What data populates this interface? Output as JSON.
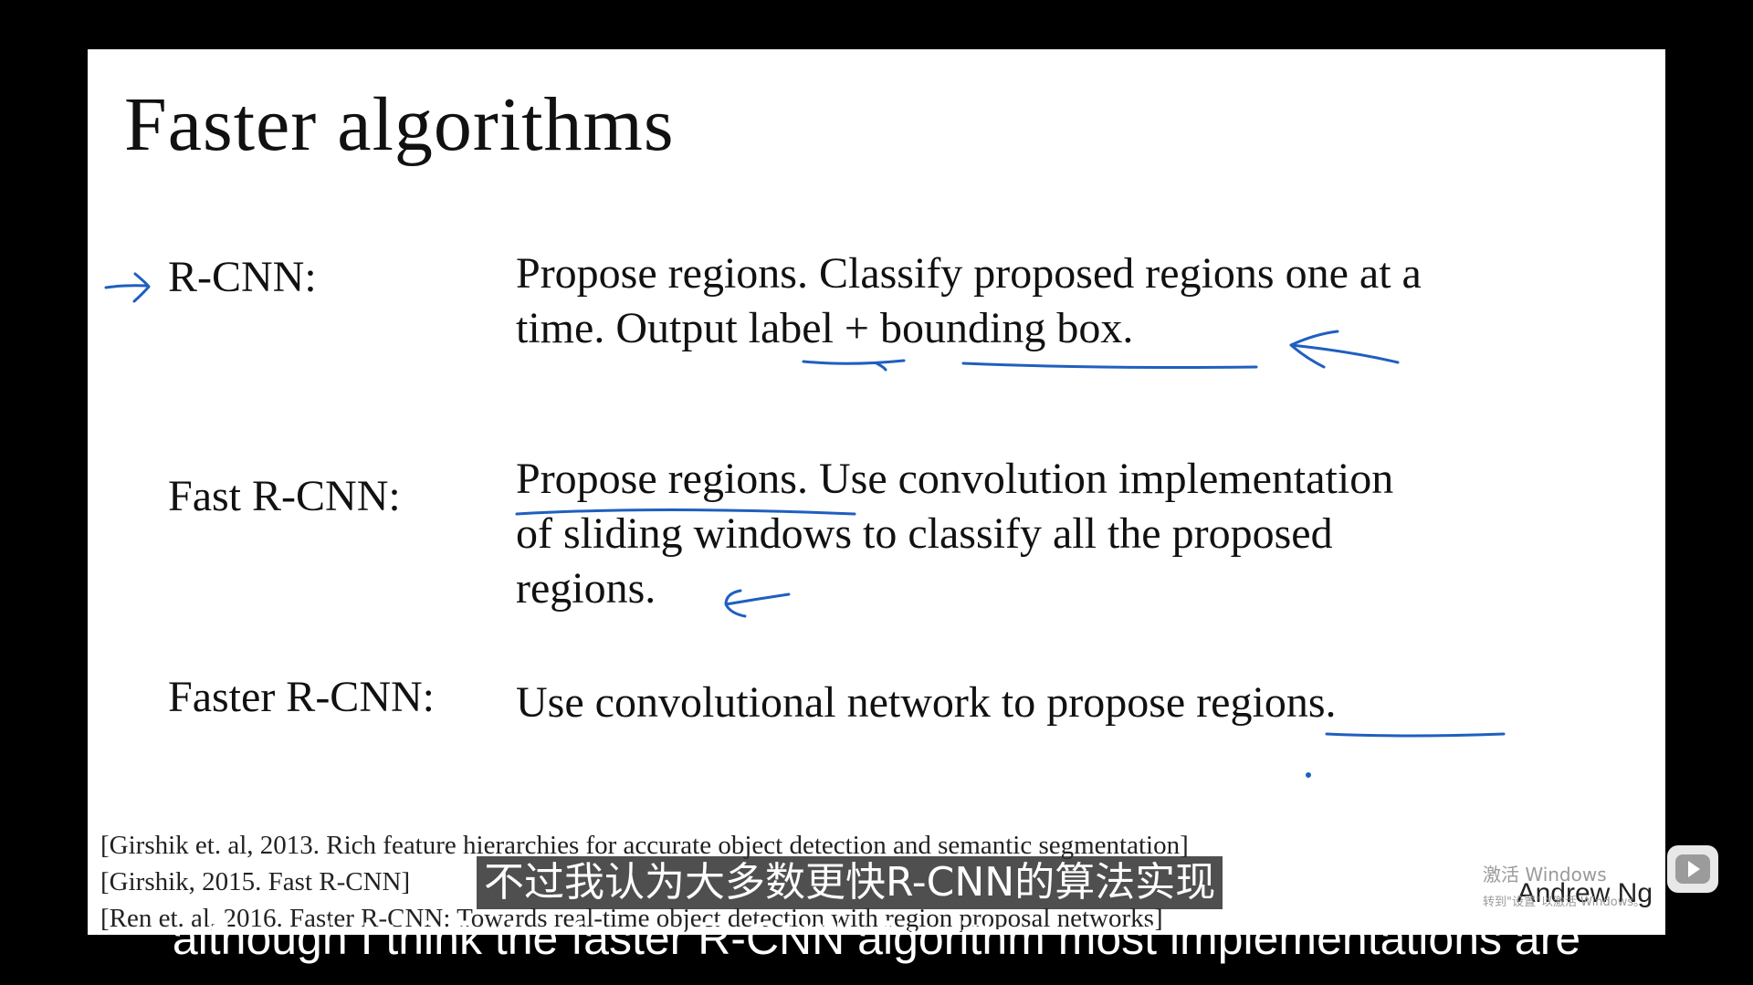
{
  "slide": {
    "title": "Faster algorithms",
    "rows": [
      {
        "label": "R-CNN:",
        "lines": [
          "Propose regions. Classify proposed regions one at a",
          "time. Output label + bounding box."
        ]
      },
      {
        "label": "Fast R-CNN:",
        "lines": [
          "Propose regions. Use convolution implementation",
          "of sliding windows to classify all the proposed",
          "regions."
        ]
      },
      {
        "label": "Faster R-CNN:",
        "lines": [
          "Use convolutional network to propose regions."
        ]
      }
    ],
    "references": [
      "[Girshik et. al, 2013. Rich feature hierarchies for accurate object detection and semantic segmentation]",
      "[Girshik, 2015. Fast R-CNN]",
      "[Ren et. al, 2016. Faster R-CNN: Towards real-time object detection with region proposal networks]"
    ],
    "author": "Andrew Ng"
  },
  "watermark": {
    "line1": "激活 Windows",
    "line2": "转到\"设置\"以激活 Windows。"
  },
  "subtitles": {
    "chinese": "不过我认为大多数更快R-CNN的算法实现",
    "english": "although I think the faster R-CNN algorithm most implementations are"
  },
  "colors": {
    "annotation_ink": "#1f5fbf",
    "subtitle_bg": "#282828",
    "background": "#000000"
  },
  "icons": {
    "player_button": "play-icon"
  }
}
